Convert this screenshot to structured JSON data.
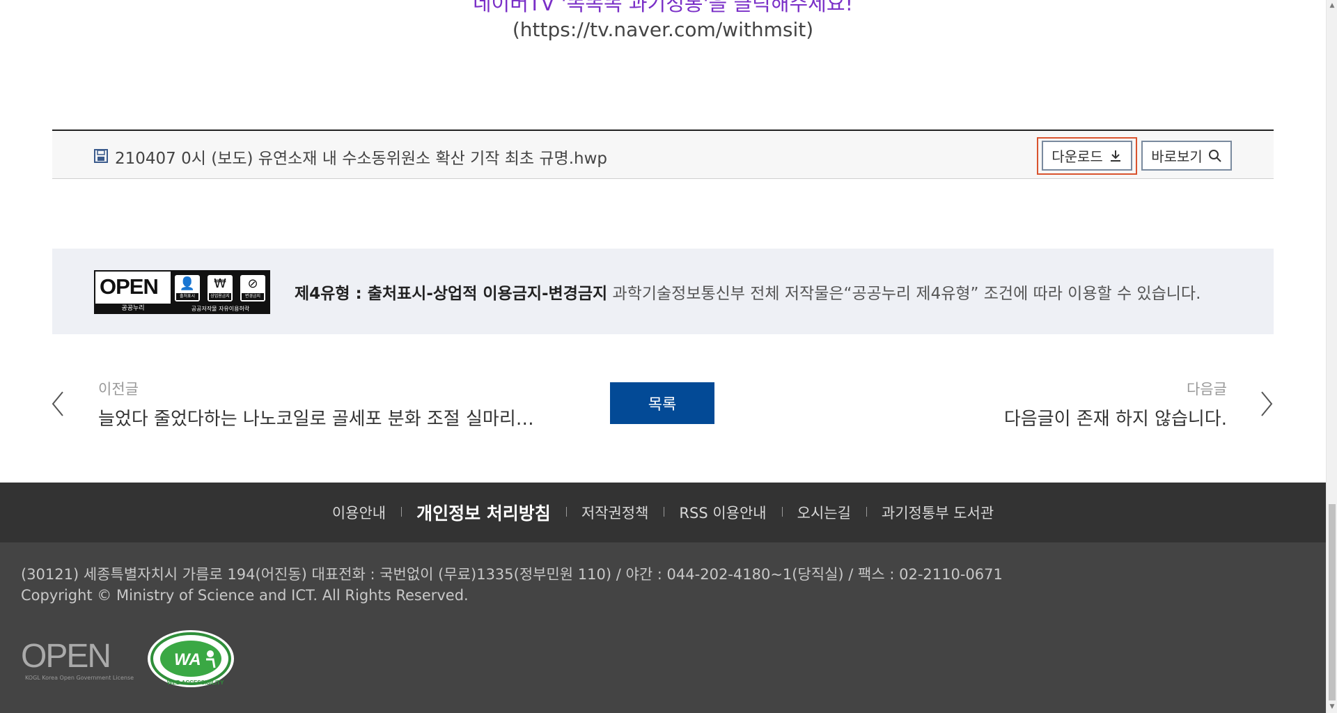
{
  "content": {
    "naver_promo": "네이버TV '똑똑똑 과기정통'을 클릭해주세요!",
    "naver_url": "(https://tv.naver.com/withmsit)"
  },
  "attachment": {
    "file_name": "210407 0시 (보도) 유연소재 내 수소동위원소 확산 기작 최초 규명.hwp",
    "download_label": "다운로드",
    "view_label": "바로보기"
  },
  "license": {
    "badge_open": "OPEN",
    "badge_sub": "공공누리",
    "badge_right_sub": "공공저작물 자유이용허락",
    "icon_labels": [
      "출처표시",
      "상업용금지",
      "변경금지"
    ],
    "type_strong": "제4유형 : 출처표시-상업적 이용금지-변경금지",
    "type_text": " 과학기술정보통신부 전체 저작물은“공공누리 제4유형” 조건에 따라 이용할 수 있습니다."
  },
  "post_nav": {
    "prev_label": "이전글",
    "prev_title": "늘었다 줄었다하는 나노코일로 골세포 분화 조절 실마리…",
    "list_label": "목록",
    "next_label": "다음글",
    "next_title": "다음글이 존재 하지 않습니다."
  },
  "footer": {
    "links": [
      "이용안내",
      "개인정보 처리방침",
      "저작권정책",
      "RSS 이용안내",
      "오시는길",
      "과기정통부 도서관"
    ],
    "address": "(30121) 세종특별자치시 가름로 194(어진동) 대표전화 : 국번없이 (무료)1335(정부민원 110) / 야간 : 044-202-4180~1(당직실) / 팩스 : 02-2110-0671",
    "copyright": "Copyright © Ministry of Science and ICT. All Rights Reserved.",
    "kogl_big": "OPEN",
    "kogl_small": "KOGL   Korea Open Government License",
    "wa_text": "WA",
    "wa_ring_text": "WEB ACCESSIBILITY"
  },
  "colors": {
    "accent_blue": "#034a96",
    "highlight_border": "#d9532e",
    "promo_purple": "#7a2fc7",
    "footer_dark": "#333333",
    "footer_info": "#444444"
  }
}
